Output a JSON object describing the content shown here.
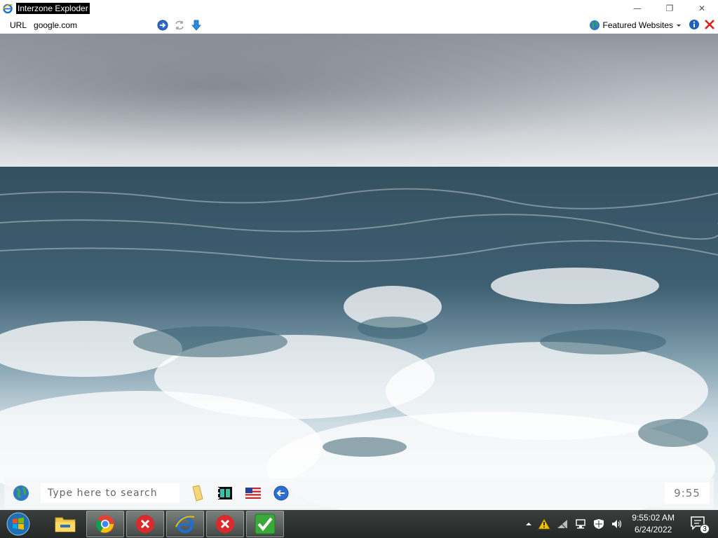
{
  "window": {
    "title": "Interzone Exploder",
    "minimize_glyph": "—",
    "restore_glyph": "❐",
    "close_glyph": "✕"
  },
  "addressbar": {
    "url_label": "URL",
    "url_value": "google.com",
    "featured_label": "Featured Websites",
    "icons": [
      "go-arrow-icon",
      "refresh-icon",
      "download-arrow-icon",
      "globe-icon",
      "dropdown-caret-icon",
      "info-icon",
      "stop-x-icon"
    ]
  },
  "desktop": {
    "wallpaper": "ocean-waves"
  },
  "searchbar": {
    "placeholder": "Type here to search",
    "clock": "9:55",
    "icons": [
      "globe-icon",
      "folder-icon",
      "film-icon",
      "us-flag-icon",
      "back-arrow-icon"
    ]
  },
  "taskbar": {
    "apps": [
      {
        "name": "file-explorer",
        "icon": "folder-icon"
      },
      {
        "name": "chrome",
        "icon": "chrome-icon"
      },
      {
        "name": "error-app-1",
        "icon": "red-x-icon"
      },
      {
        "name": "internet-explorer",
        "icon": "ie-icon"
      },
      {
        "name": "error-app-2",
        "icon": "red-x-icon"
      },
      {
        "name": "checkmark-app",
        "icon": "green-check-icon"
      }
    ],
    "time": "9:55:02 AM",
    "date": "6/24/2022",
    "notification_count": "3"
  },
  "colors": {
    "taskbar": "#2b302e",
    "ie_blue": "#1e6fd0",
    "error_red": "#d92b2b",
    "check_green": "#3aa83a"
  }
}
